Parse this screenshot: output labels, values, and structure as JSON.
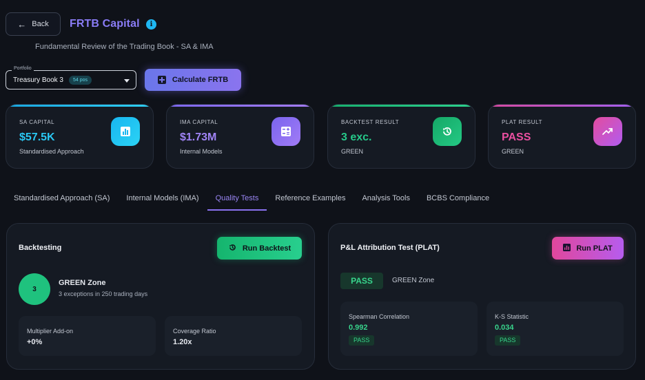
{
  "header": {
    "back_label": "Back",
    "title": "FRTB Capital",
    "subtitle": "Fundamental Review of the Trading Book - SA & IMA"
  },
  "portfolio": {
    "legend": "Portfolio",
    "value": "Treasury Book 3",
    "badge": "54 pos"
  },
  "calculate_label": "Calculate FRTB",
  "cards": [
    {
      "label": "SA CAPITAL",
      "value": "$57.5K",
      "sub": "Standardised Approach",
      "color": "#26c6f4",
      "icon": "bar-chart-icon"
    },
    {
      "label": "IMA CAPITAL",
      "value": "$1.73M",
      "sub": "Internal Models",
      "color": "#9a7cf6",
      "icon": "calculator-icon"
    },
    {
      "label": "BACKTEST RESULT",
      "value": "3 exc.",
      "sub": "GREEN",
      "color": "#1fc27e",
      "icon": "history-icon"
    },
    {
      "label": "PLAT RESULT",
      "value": "PASS",
      "sub": "GREEN",
      "color": "#ea4fa0",
      "icon": "trending-up-icon"
    }
  ],
  "tabs": [
    {
      "label": "Standardised Approach (SA)",
      "active": false
    },
    {
      "label": "Internal Models (IMA)",
      "active": false
    },
    {
      "label": "Quality Tests",
      "active": true
    },
    {
      "label": "Reference Examples",
      "active": false
    },
    {
      "label": "Analysis Tools",
      "active": false
    },
    {
      "label": "BCBS Compliance",
      "active": false
    }
  ],
  "backtesting": {
    "title": "Backtesting",
    "run_label": "Run Backtest",
    "exceptions": "3",
    "zone": "GREEN Zone",
    "zone_sub": "3 exceptions in 250 trading days",
    "multiplier_label": "Multiplier Add-on",
    "multiplier_value": "+0%",
    "coverage_label": "Coverage Ratio",
    "coverage_value": "1.20x"
  },
  "plat": {
    "title": "P&L Attribution Test (PLAT)",
    "run_label": "Run PLAT",
    "result": "PASS",
    "zone": "GREEN Zone",
    "spearman_label": "Spearman Correlation",
    "spearman_value": "0.992",
    "spearman_status": "PASS",
    "ks_label": "K-S Statistic",
    "ks_value": "0.034",
    "ks_status": "PASS"
  }
}
